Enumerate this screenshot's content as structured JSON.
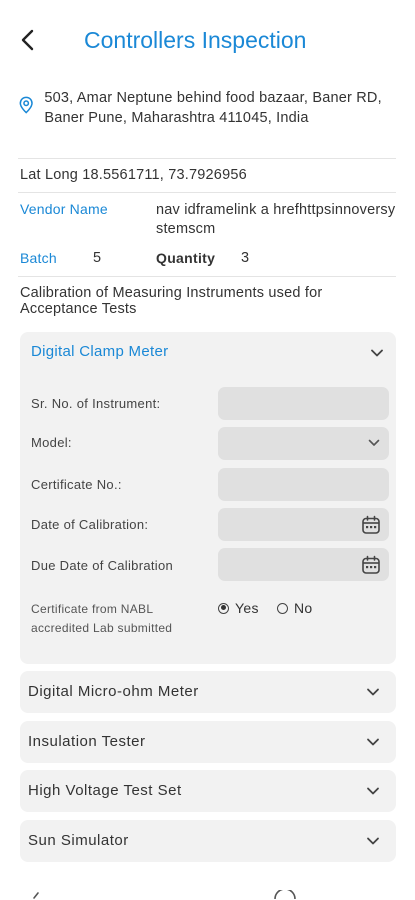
{
  "header": {
    "title": "Controllers Inspection",
    "back_icon": "chevron-left-icon"
  },
  "site": {
    "address": "503, Amar Neptune behind food bazaar, Baner RD,  Baner Pune, Maharashtra 411045, India",
    "lat_long": "Lat Long 18.5561711, 73.7926956"
  },
  "vendor": {
    "label": "Vendor Name",
    "value": "nav idframelink a hrefhttpsinnoversystemscm"
  },
  "batch": {
    "label": "Batch",
    "value": "5"
  },
  "quantity": {
    "label": "Quantity",
    "value": "3"
  },
  "calibration_heading": "Calibration of Measuring Instruments used for Acceptance Tests",
  "instruments": {
    "open": {
      "title": "Digital Clamp Meter",
      "fields": {
        "serial_label": "Sr. No. of Instrument:",
        "serial_value": "",
        "model_label": "Model:",
        "model_value": "",
        "certificate_label": "Certificate No.:",
        "certificate_value": "",
        "calibration_date_label": "Date of Calibration:",
        "calibration_date_value": "",
        "due_date_label": "Due Date of Calibration",
        "due_date_value": "",
        "nabl_label": "Certificate from NABL accredited Lab submitted",
        "yes_label": "Yes",
        "no_label": "No",
        "nabl_selected": "Yes"
      }
    },
    "collapsed": [
      {
        "title": "Digital Micro-ohm Meter"
      },
      {
        "title": "Insulation Tester"
      },
      {
        "title": "High Voltage Test Set"
      },
      {
        "title": "Sun Simulator"
      }
    ]
  },
  "colors": {
    "accent": "#1a88d6",
    "panel_bg": "#f2f2f2",
    "input_bg": "#e0e0e0"
  }
}
